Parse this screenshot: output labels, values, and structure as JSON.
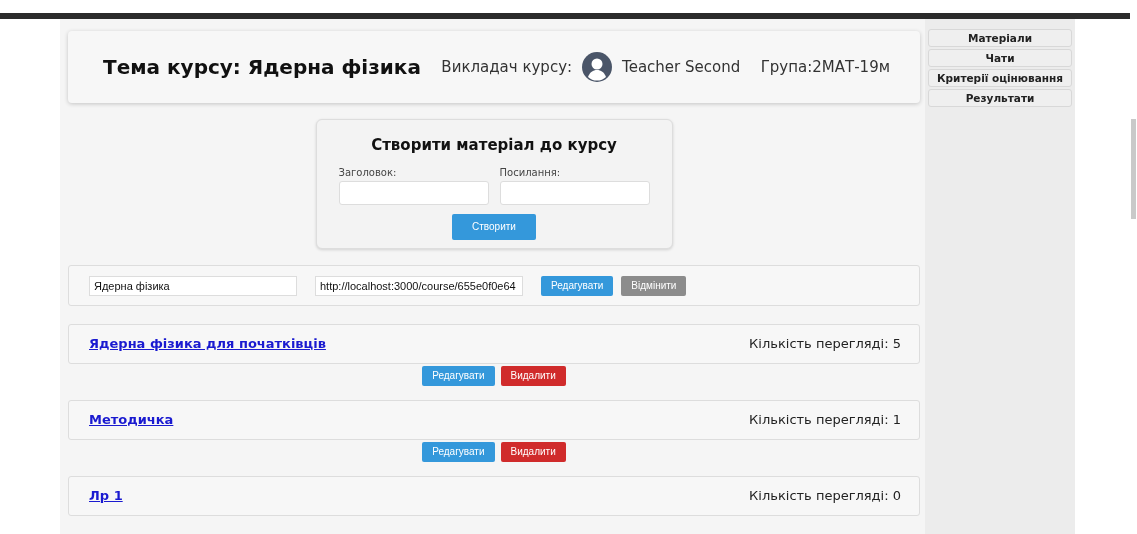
{
  "header": {
    "title": "Тема курсу: Ядерна фізика",
    "teacher_label": "Викладач курсу:",
    "teacher_name": "Teacher Second",
    "group": "Група:2МАТ-19м"
  },
  "sidebar": {
    "items": [
      "Матеріали",
      "Чати",
      "Критерії оцінювання",
      "Результати"
    ]
  },
  "create_form": {
    "title": "Створити матеріал до курсу",
    "fields": [
      {
        "label": "Заголовок:"
      },
      {
        "label": "Посилання:"
      }
    ],
    "button": "Створити"
  },
  "edit_row": {
    "fields": [
      {
        "value": "Ядерна фізика"
      },
      {
        "value": "http://localhost:3000/course/655e0f0e64"
      }
    ],
    "buttons": [
      {
        "label": "Редагувати",
        "kind": "primary"
      },
      {
        "label": "Відмінити",
        "kind": "secondary"
      }
    ]
  },
  "materials": [
    {
      "title": "Ядерна фізика для початківців",
      "views": "Кількість перегляді: 5",
      "buttons": [
        {
          "label": "Редагувати",
          "kind": "primary"
        },
        {
          "label": "Видалити",
          "kind": "danger"
        }
      ]
    },
    {
      "title": "Методичка",
      "views": "Кількість перегляді: 1",
      "buttons": [
        {
          "label": "Редагувати",
          "kind": "primary"
        },
        {
          "label": "Видалити",
          "kind": "danger"
        }
      ]
    },
    {
      "title": "Лр 1",
      "views": "Кількість перегляді: 0"
    }
  ]
}
